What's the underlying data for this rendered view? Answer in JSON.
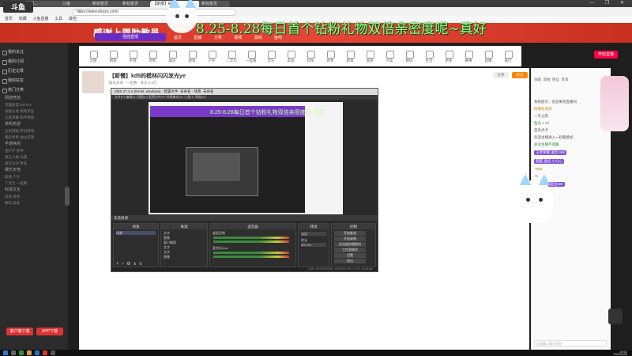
{
  "browser": {
    "tabs": [
      "主播…",
      "斗鱼",
      "新标签页",
      "新标签页",
      "【斯慢】kd5...",
      "新标签页"
    ],
    "address": "https://www.douyu.com/",
    "bookmarks": [
      "首页",
      "收藏",
      "斗鱼直播",
      "工具",
      "其他"
    ],
    "window_controls": "— ❐ ✕"
  },
  "site": {
    "logo": "斗鱼",
    "banner_title": "感谢上周助教员",
    "banner_ad": "强强登场",
    "nav": [
      "首页",
      "直播",
      "分类",
      "视频",
      "游戏",
      "鱼吧"
    ],
    "marquee": "8.25-8.28每日首个钻粉礼物双倍亲密度呢~真好",
    "live_button": "开始直播"
  },
  "sidebar": {
    "items": [
      "我的关注",
      "我的订阅",
      "历史记录",
      "我的好友",
      "热门分类"
    ],
    "categories": [
      {
        "title": "网游竞技",
        "subs": [
          "英雄联盟 DOTA2",
          "穿越火线 绝地求生",
          "王者荣耀 和平精英"
        ]
      },
      {
        "title": "单机热游",
        "subs": [
          "主机游戏 怀旧游戏",
          "我的世界 独立游戏"
        ]
      },
      {
        "title": "手游休闲",
        "subs": [
          "金铲铲 原神",
          "第五人格 光遇",
          "蛋仔派对 更多"
        ]
      },
      {
        "title": "娱乐天地",
        "subs": [
          "颜值 户外",
          "二次元 一起看"
        ]
      },
      {
        "title": "科技文化",
        "subs": [
          "科技 教育",
          "数码 美食"
        ]
      }
    ],
    "btn_download": "客户端下载",
    "btn_app": "APP下载"
  },
  "category_strip": [
    "全部",
    "网游",
    "手游",
    "单机",
    "娱乐",
    "颜值",
    "户外",
    "二次元",
    "一起看",
    "音乐",
    "美食",
    "科技",
    "体育",
    "教育",
    "旅游",
    "汽车",
    "数码",
    "生活",
    "更多",
    "赛事",
    "直播",
    "排行"
  ],
  "streamer": {
    "title": "【斯慢】kd5的模林闪闪发光ye",
    "meta": "娱乐天地 · 一起看 · 关注 2.9万",
    "share": "分享",
    "follow": "关注"
  },
  "obs": {
    "title": "OBS 27.2.4 (64-bit, windows) - 配置文件: 未命名 - 场景: 未命名",
    "menu": "文件(F)  编辑(E)  视图(V)  配置文件(P)  场景集合(S)  工具(T)  帮助(H)",
    "source_label": "未选择源",
    "nested_marquee": "8.25-8.28每日首个钻粉礼物双倍亲密度呢~真好",
    "scenes_header": "场景",
    "scenes": [
      "场景"
    ],
    "sources_header": "来源",
    "sources": [
      "文字",
      "图像",
      "窗口捕获",
      "文字",
      "文字",
      "图像"
    ],
    "mixer_header": "混音器",
    "mixer": [
      "桌面音频",
      "麦克风/Aux"
    ],
    "transitions_header": "转场",
    "transition": "淡出",
    "duration_label": "时长",
    "duration": "300 ms",
    "controls_header": "控制",
    "controls": [
      "开始推流",
      "开始录制",
      "启动虚拟摄像机",
      "工作室模式",
      "设置",
      "退出"
    ],
    "status": "LIVE: 00:00:00  REC: 00:00:00  CPU: 1.2%, 30.00 fps"
  },
  "right_panel": {
    "tabs": [
      "贡献",
      "周榜",
      "粉丝",
      "贵宾"
    ],
    "chat": [
      {
        "t": "系统提示：欢迎来到直播间",
        "c": ""
      },
      {
        "t": "叫我何洛洛",
        "c": "gold"
      },
      {
        "t": "一天之际",
        "c": ""
      },
      {
        "t": "鱼丸 x 10",
        "c": "hl"
      },
      {
        "t": "是有点卡",
        "c": ""
      },
      {
        "t": "欢迎主播进入一起看模式",
        "c": ""
      },
      {
        "t": "关注主播不迷路",
        "c": "hl"
      },
      {
        "t": "王者荣耀 送出 666",
        "c": "gift"
      },
      {
        "t": "超酷 送出 小心心",
        "c": "gift"
      },
      {
        "t": "+666",
        "c": "gold"
      },
      {
        "t": "+1",
        "c": ""
      },
      {
        "t": "王者荣耀送出666",
        "c": "gift"
      }
    ],
    "chat_placeholder": "这里输入聊天内容"
  },
  "taskbar": {
    "time": "19:52",
    "date": "2022/8/26"
  }
}
